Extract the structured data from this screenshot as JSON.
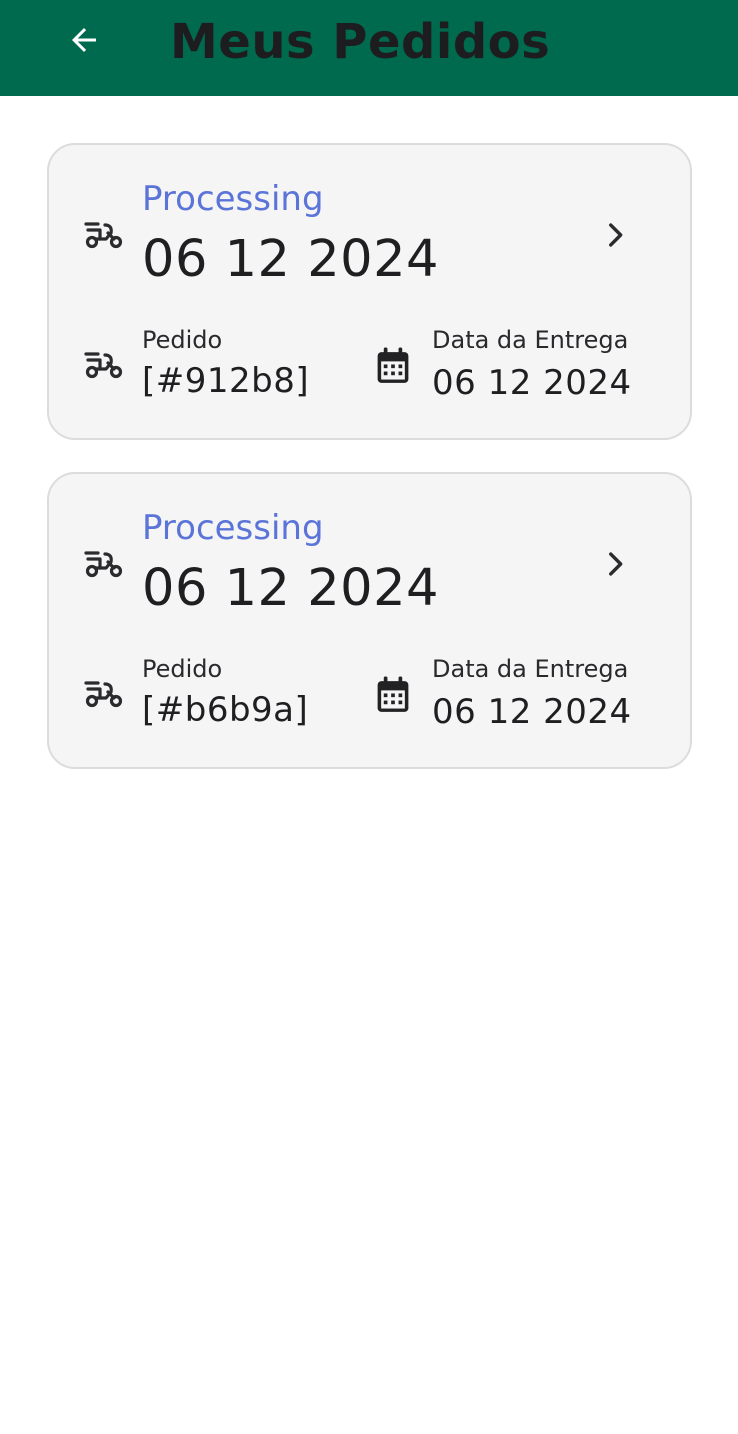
{
  "header": {
    "title": "Meus Pedidos",
    "back_icon": "arrow-left-icon",
    "background_color": "#006A4E"
  },
  "orders": [
    {
      "status": "Processing",
      "date": "06 12 2024",
      "order_label": "Pedido",
      "order_id": "[#912b8]",
      "delivery_label": "Data da Entrega",
      "delivery_date": "06 12 2024"
    },
    {
      "status": "Processing",
      "date": "06 12 2024",
      "order_label": "Pedido",
      "order_id": "[#b6b9a]",
      "delivery_label": "Data da Entrega",
      "delivery_date": "06 12 2024"
    }
  ],
  "colors": {
    "status": "#5b74d8",
    "card_background": "#f5f5f6",
    "card_border": "#dcdcdc"
  },
  "icons": {
    "status": "scooter-icon",
    "order": "scooter-icon",
    "navigate": "chevron-right-icon",
    "delivery": "calendar-icon"
  }
}
